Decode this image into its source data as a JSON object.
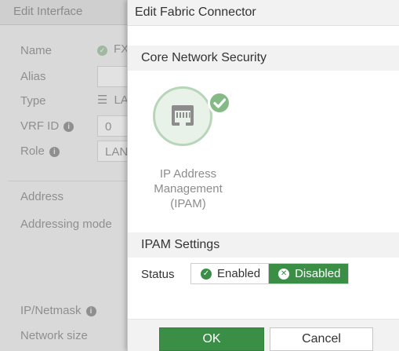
{
  "background_page": {
    "title": "Edit Interface",
    "fields": {
      "name_label": "Name",
      "name_value": "FX",
      "alias_label": "Alias",
      "type_label": "Type",
      "type_value": "LA",
      "vrf_label": "VRF ID",
      "vrf_value": "0",
      "role_label": "Role",
      "role_value": "LAN"
    },
    "address_section": "Address",
    "addressing_mode_label": "Addressing mode",
    "ip_netmask_label": "IP/Netmask",
    "network_size_label": "Network size"
  },
  "panel": {
    "title": "Edit Fabric Connector",
    "section_core": "Core Network Security",
    "connector": {
      "label_line1": "IP Address",
      "label_line2": "Management",
      "label_line3": "(IPAM)",
      "icon": "ethernet-port-icon",
      "status_icon": "check-badge-icon"
    },
    "section_settings": "IPAM Settings",
    "status": {
      "label": "Status",
      "enabled_label": "Enabled",
      "disabled_label": "Disabled",
      "selected": "Disabled"
    },
    "buttons": {
      "ok": "OK",
      "cancel": "Cancel"
    }
  },
  "colors": {
    "accent_green": "#3a8e46",
    "light_green": "#83ba85",
    "header_gray": "#f2f2f2"
  }
}
